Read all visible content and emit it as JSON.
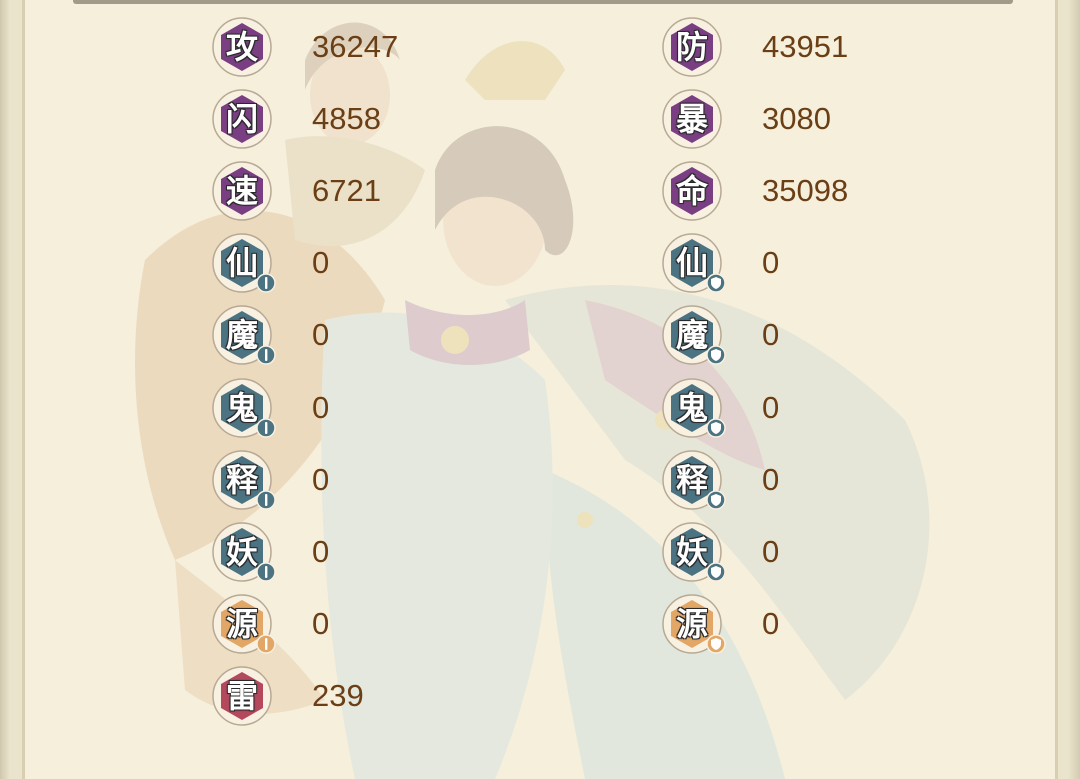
{
  "colors": {
    "purple": "#7a3f82",
    "teal": "#4b7382",
    "orange": "#e2a766",
    "red": "#b4485c",
    "value_text": "#6b3f16"
  },
  "stats_left": [
    {
      "label": "攻",
      "value": "36247",
      "color": "purple",
      "sub": ""
    },
    {
      "label": "闪",
      "value": "4858",
      "color": "purple",
      "sub": ""
    },
    {
      "label": "速",
      "value": "6721",
      "color": "purple",
      "sub": ""
    },
    {
      "label": "仙",
      "value": "0",
      "color": "teal",
      "sub": "attack-sword-icon"
    },
    {
      "label": "魔",
      "value": "0",
      "color": "teal",
      "sub": "attack-sword-icon"
    },
    {
      "label": "鬼",
      "value": "0",
      "color": "teal",
      "sub": "attack-sword-icon"
    },
    {
      "label": "释",
      "value": "0",
      "color": "teal",
      "sub": "attack-sword-icon"
    },
    {
      "label": "妖",
      "value": "0",
      "color": "teal",
      "sub": "attack-sword-icon"
    },
    {
      "label": "源",
      "value": "0",
      "color": "orange",
      "sub": "attack-sword-icon"
    },
    {
      "label": "雷",
      "value": "239",
      "color": "red",
      "sub": ""
    }
  ],
  "stats_right": [
    {
      "label": "防",
      "value": "43951",
      "color": "purple",
      "sub": ""
    },
    {
      "label": "暴",
      "value": "3080",
      "color": "purple",
      "sub": ""
    },
    {
      "label": "命",
      "value": "35098",
      "color": "purple",
      "sub": ""
    },
    {
      "label": "仙",
      "value": "0",
      "color": "teal",
      "sub": "defense-shield-icon"
    },
    {
      "label": "魔",
      "value": "0",
      "color": "teal",
      "sub": "defense-shield-icon"
    },
    {
      "label": "鬼",
      "value": "0",
      "color": "teal",
      "sub": "defense-shield-icon"
    },
    {
      "label": "释",
      "value": "0",
      "color": "teal",
      "sub": "defense-shield-icon"
    },
    {
      "label": "妖",
      "value": "0",
      "color": "teal",
      "sub": "defense-shield-icon"
    },
    {
      "label": "源",
      "value": "0",
      "color": "orange",
      "sub": "defense-shield-icon"
    }
  ]
}
